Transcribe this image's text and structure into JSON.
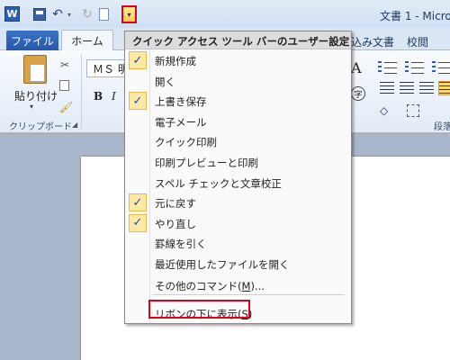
{
  "window": {
    "title": "文書 1 - Micro"
  },
  "qat": {
    "app_icon_letter": "W",
    "undo_glyph": "↶",
    "undo_dropdown_glyph": "▾",
    "redo_glyph": "↻",
    "customize_glyph": "▾"
  },
  "tabs": {
    "file": "ファイル",
    "home": "ホーム",
    "mailings": "込み文書",
    "review": "校閲"
  },
  "ribbon": {
    "paste_label": "貼り付け",
    "paste_arrow": "▾",
    "cut_glyph": "✂",
    "brush_glyph": "🖌",
    "clipboard_group_label": "クリップボード",
    "launcher_glyph": "◢",
    "font_name": "ＭＳ 明",
    "bold_glyph": "B",
    "italic_glyph": "I",
    "a_glyph": "A",
    "char_circle_glyph": "字",
    "fill_glyph": "◇",
    "paragraph_group_label": "段落"
  },
  "menu": {
    "header": "クイック アクセス ツール バーのユーザー設定",
    "check_glyph": "✓",
    "items": [
      {
        "label": "新規作成",
        "checked": true
      },
      {
        "label": "開く",
        "checked": false
      },
      {
        "label": "上書き保存",
        "checked": true
      },
      {
        "label": "電子メール",
        "checked": false
      },
      {
        "label": "クイック印刷",
        "checked": false
      },
      {
        "label": "印刷プレビューと印刷",
        "checked": false
      },
      {
        "label": "スペル チェックと文章校正",
        "checked": false
      },
      {
        "label": "元に戻す",
        "checked": true
      },
      {
        "label": "やり直し",
        "checked": true
      },
      {
        "label": "罫線を引く",
        "checked": false
      },
      {
        "label": "最近使用したファイルを開く",
        "checked": false
      }
    ],
    "more_commands": {
      "label": "その他のコマンド(",
      "key": "M",
      "suffix": ")..."
    },
    "show_below": {
      "label": "リボンの下に表示(",
      "key": "S",
      "suffix": ")"
    }
  },
  "colors": {
    "highlight_border": "#e0001b",
    "check_bg": "#fde8a6",
    "file_tab": "#2b5fb4"
  }
}
